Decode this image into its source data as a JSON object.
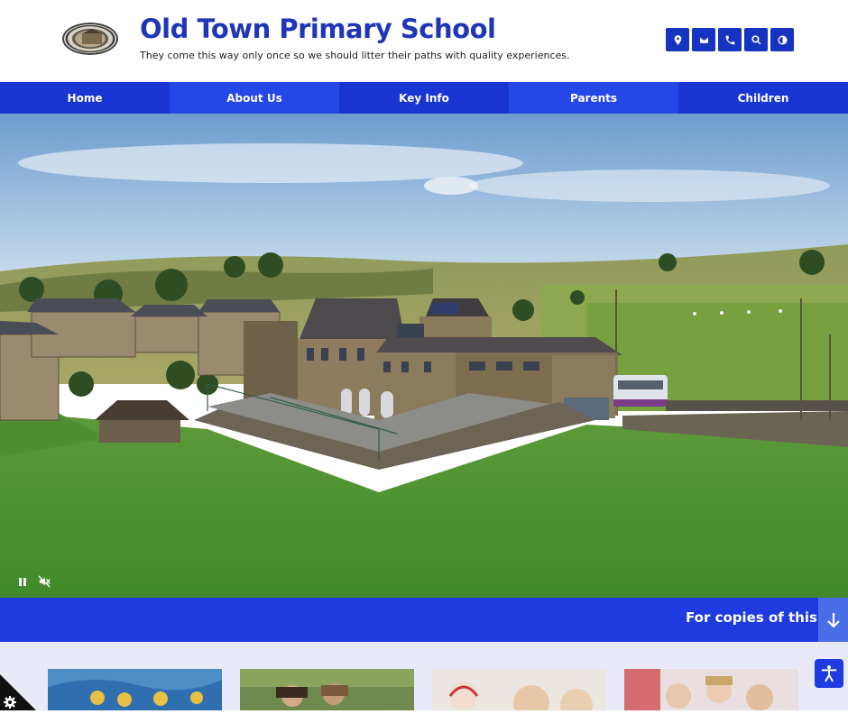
{
  "header": {
    "title": "Old Town Primary School",
    "tagline": "They come this way only once so we should litter their paths with quality experiences.",
    "logo_icon": "school-crest-logo",
    "quick_links": [
      {
        "icon": "map-pin-icon"
      },
      {
        "icon": "mail-icon"
      },
      {
        "icon": "phone-icon"
      },
      {
        "icon": "search-icon"
      },
      {
        "icon": "contrast-icon"
      }
    ]
  },
  "nav": {
    "items": [
      {
        "label": "Home"
      },
      {
        "label": "About Us"
      },
      {
        "label": "Key Info"
      },
      {
        "label": "Parents"
      },
      {
        "label": "Children"
      }
    ]
  },
  "hero": {
    "pause_icon": "pause-icon",
    "mute_icon": "mute-icon"
  },
  "banner": {
    "text": "For copies of this po",
    "down_icon": "arrow-down-icon"
  },
  "colors": {
    "brand_blue": "#1f3be0",
    "title_blue": "#1f36b8",
    "light_bg": "#e8eaf8"
  },
  "accessibility": {
    "icon": "accessibility-icon"
  },
  "cookie": {
    "icon": "gear-icon"
  }
}
